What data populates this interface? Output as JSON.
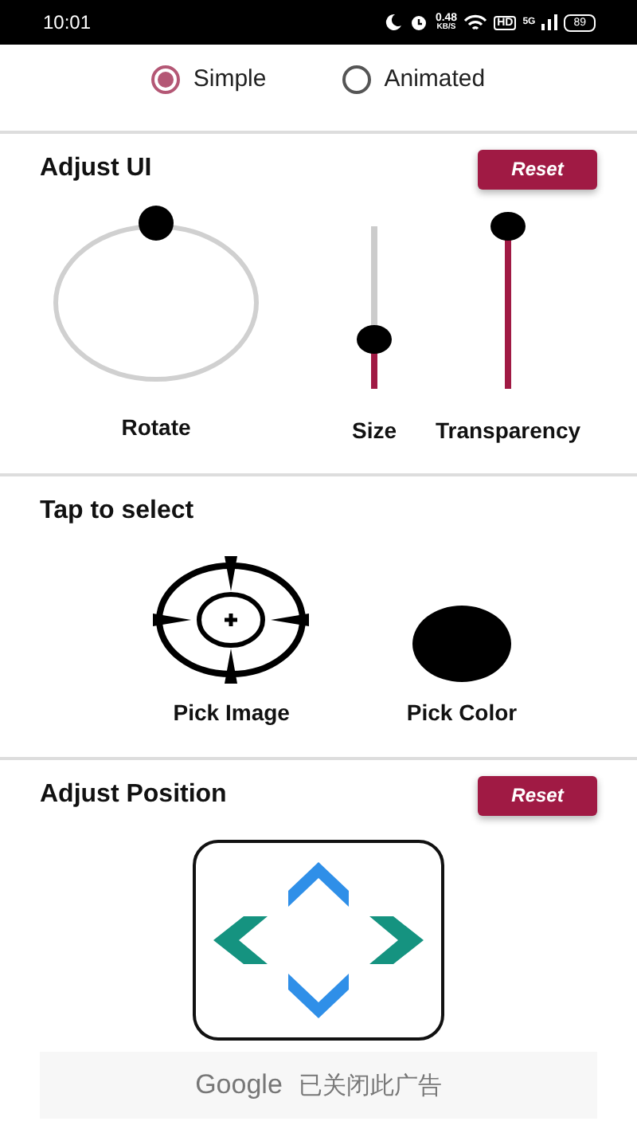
{
  "status_bar": {
    "time": "10:01",
    "speed": "0.48",
    "speed_unit": "KB/S",
    "hd": "HD",
    "network": "5G",
    "battery": "89"
  },
  "mode_options": [
    {
      "label": "Simple",
      "selected": true
    },
    {
      "label": "Animated",
      "selected": false
    }
  ],
  "adjust_ui": {
    "title": "Adjust UI",
    "reset": "Reset",
    "rotate_label": "Rotate",
    "sliders": [
      {
        "label": "Size",
        "level": 0.3
      },
      {
        "label": "Transparency",
        "level": 1
      }
    ]
  },
  "tap_to_select": {
    "title": "Tap to select",
    "items": [
      {
        "kind": "image",
        "label": "Pick Image"
      },
      {
        "kind": "color",
        "label": "Pick Color",
        "color": "#000000"
      }
    ]
  },
  "adjust_position": {
    "title": "Adjust Position",
    "reset": "Reset"
  },
  "ad_bar": {
    "brand": "Google",
    "message": "已关闭此广告"
  }
}
